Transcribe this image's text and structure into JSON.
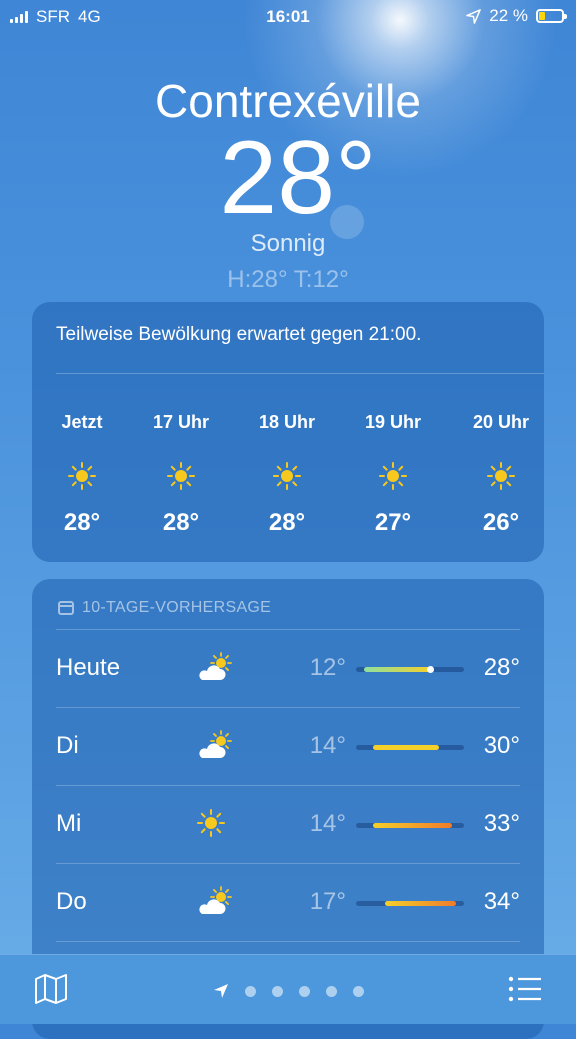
{
  "status": {
    "carrier": "SFR",
    "network": "4G",
    "time": "16:01",
    "battery": "22 %"
  },
  "location": {
    "city": "Contrexéville",
    "temperature": "28°",
    "condition": "Sonnig",
    "high_low": "H:28°  T:12°"
  },
  "hourly": {
    "summary": "Teilweise Bewölkung erwartet gegen 21:00.",
    "items": [
      {
        "time": "Jetzt",
        "icon": "sun-icon",
        "temp": "28°"
      },
      {
        "time": "17 Uhr",
        "icon": "sun-icon",
        "temp": "28°"
      },
      {
        "time": "18 Uhr",
        "icon": "sun-icon",
        "temp": "28°"
      },
      {
        "time": "19 Uhr",
        "icon": "sun-icon",
        "temp": "27°"
      },
      {
        "time": "20 Uhr",
        "icon": "sun-icon",
        "temp": "26°"
      }
    ]
  },
  "daily": {
    "header": "10-TAGE-VORHERSAGE",
    "days": [
      {
        "day": "Heute",
        "icon": "partly-cloudy-icon",
        "low": "12°",
        "high": "28°",
        "low_value": 12,
        "high_value": 28,
        "current_value": 28
      },
      {
        "day": "Di",
        "icon": "partly-cloudy-icon",
        "low": "14°",
        "high": "30°",
        "low_value": 14,
        "high_value": 30
      },
      {
        "day": "Mi",
        "icon": "sun-icon",
        "low": "14°",
        "high": "33°",
        "low_value": 14,
        "high_value": 33
      },
      {
        "day": "Do",
        "icon": "partly-cloudy-icon",
        "low": "17°",
        "high": "34°",
        "low_value": 17,
        "high_value": 34
      }
    ],
    "range_min": 10,
    "range_max": 36
  },
  "colors": {
    "sun": "#f7c81e",
    "bar_cool": "#8ee0a0",
    "bar_warm": "#f5d02a",
    "bar_hot": "#f07b2a"
  }
}
